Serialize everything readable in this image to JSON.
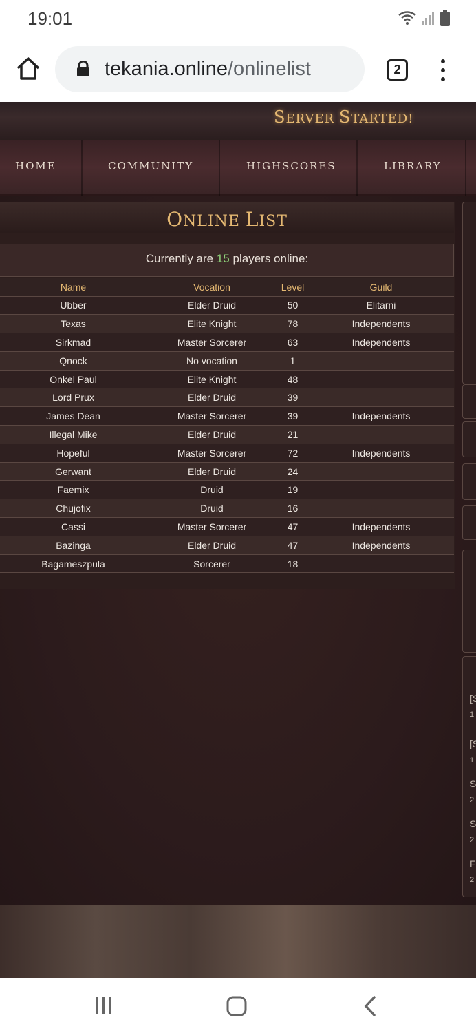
{
  "status": {
    "time": "19:01"
  },
  "browser": {
    "url_domain": "tekania.online",
    "url_path": "/onlinelist",
    "tab_count": "2"
  },
  "site": {
    "banner": [
      "S",
      "ERVER ",
      "S",
      "TARTED!"
    ],
    "nav": [
      "HOME",
      "COMMUNITY",
      "HIGHSCORES",
      "LIBRARY"
    ]
  },
  "panel": {
    "title_caps": [
      "O",
      "NLINE ",
      "L",
      "IST"
    ],
    "online_prefix": "Currently are",
    "online_count": "15",
    "online_suffix": "players online:"
  },
  "table": {
    "headers": [
      "Name",
      "Vocation",
      "Level",
      "Guild"
    ],
    "rows": [
      [
        "Ubber",
        "Elder Druid",
        "50",
        "Elitarni"
      ],
      [
        "Texas",
        "Elite Knight",
        "78",
        "Independents"
      ],
      [
        "Sirkmad",
        "Master Sorcerer",
        "63",
        "Independents"
      ],
      [
        "Qnock",
        "No vocation",
        "1",
        ""
      ],
      [
        "Onkel Paul",
        "Elite Knight",
        "48",
        ""
      ],
      [
        "Lord Prux",
        "Elder Druid",
        "39",
        ""
      ],
      [
        "James Dean",
        "Master Sorcerer",
        "39",
        "Independents"
      ],
      [
        "Illegal Mike",
        "Elder Druid",
        "21",
        ""
      ],
      [
        "Hopeful",
        "Master Sorcerer",
        "72",
        "Independents"
      ],
      [
        "Gerwant",
        "Elder Druid",
        "24",
        ""
      ],
      [
        "Faemix",
        "Druid",
        "19",
        ""
      ],
      [
        "Chujofix",
        "Druid",
        "16",
        ""
      ],
      [
        "Cassi",
        "Master Sorcerer",
        "47",
        "Independents"
      ],
      [
        "Bazinga",
        "Elder Druid",
        "47",
        "Independents"
      ],
      [
        "Bagameszpula",
        "Sorcerer",
        "18",
        ""
      ]
    ]
  },
  "sidebar": {
    "snippets": [
      "[S",
      "1",
      "[S",
      "1",
      "S",
      "2",
      "S",
      "2",
      "F",
      "2"
    ]
  },
  "colors": {
    "accent": "#e4b872",
    "count": "#8fd37a"
  }
}
